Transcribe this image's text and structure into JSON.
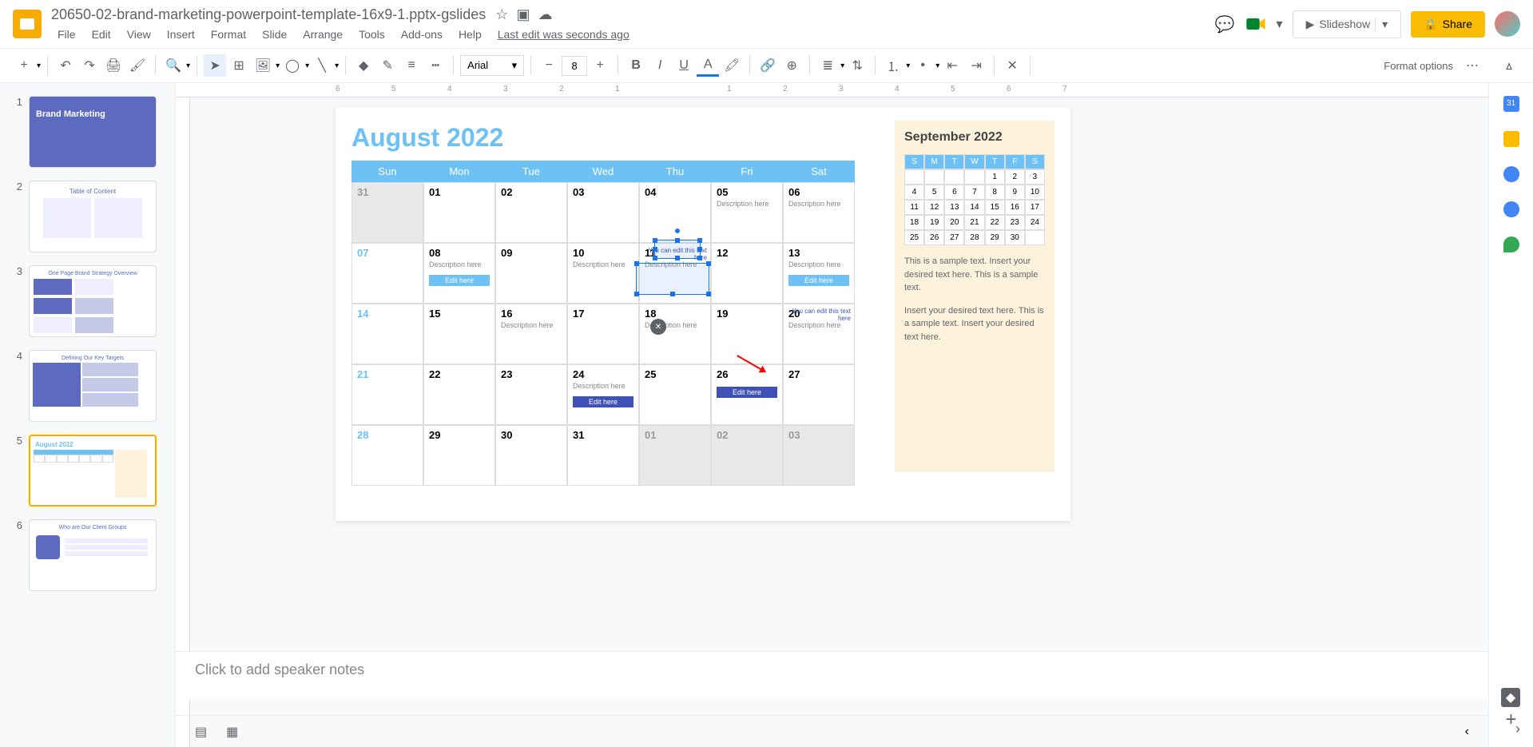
{
  "doc": {
    "title": "20650-02-brand-marketing-powerpoint-template-16x9-1.pptx-gslides"
  },
  "menu": {
    "file": "File",
    "edit": "Edit",
    "view": "View",
    "insert": "Insert",
    "format": "Format",
    "slide": "Slide",
    "arrange": "Arrange",
    "tools": "Tools",
    "addons": "Add-ons",
    "help": "Help",
    "last_edit": "Last edit was seconds ago"
  },
  "actions": {
    "slideshow": "Slideshow",
    "share": "Share"
  },
  "toolbar": {
    "font": "Arial",
    "size": "8",
    "format_options": "Format options"
  },
  "thumbs": [
    {
      "num": "1",
      "label": "Brand Marketing"
    },
    {
      "num": "2",
      "label": "Table of Content"
    },
    {
      "num": "3",
      "label": "One Page Brand Strategy Overview"
    },
    {
      "num": "4",
      "label": "Defining Our Key Targets"
    },
    {
      "num": "5",
      "label": "August 2022"
    },
    {
      "num": "6",
      "label": "Who are Our Client Groups"
    }
  ],
  "calendar": {
    "title": "August 2022",
    "days": [
      "Sun",
      "Mon",
      "Tue",
      "Wed",
      "Thu",
      "Fri",
      "Sat"
    ],
    "cells": [
      {
        "n": "31",
        "gray": true
      },
      {
        "n": "01"
      },
      {
        "n": "02"
      },
      {
        "n": "03"
      },
      {
        "n": "04"
      },
      {
        "n": "05",
        "desc": "Description here"
      },
      {
        "n": "06",
        "desc": "Description here"
      },
      {
        "n": "07",
        "sun": true
      },
      {
        "n": "08",
        "desc": "Description here",
        "btn": "Edit here",
        "light": true
      },
      {
        "n": "09"
      },
      {
        "n": "10",
        "desc": "Description here"
      },
      {
        "n": "11",
        "desc": "Description here",
        "edit": "You can edit this text here",
        "sel": true
      },
      {
        "n": "12"
      },
      {
        "n": "13",
        "desc": "Description here",
        "btn": "Edit here",
        "light": true
      },
      {
        "n": "14",
        "sun": true
      },
      {
        "n": "15"
      },
      {
        "n": "16",
        "desc": "Description here"
      },
      {
        "n": "17"
      },
      {
        "n": "18",
        "desc": "Description here"
      },
      {
        "n": "19"
      },
      {
        "n": "20",
        "desc": "Description here",
        "edit": "You can edit this text here"
      },
      {
        "n": "21",
        "sun": true
      },
      {
        "n": "22"
      },
      {
        "n": "23"
      },
      {
        "n": "24",
        "desc": "Description here",
        "btn": "Edit here"
      },
      {
        "n": "25"
      },
      {
        "n": "26",
        "btn": "Edit here"
      },
      {
        "n": "27"
      },
      {
        "n": "28",
        "sun": true
      },
      {
        "n": "29"
      },
      {
        "n": "30"
      },
      {
        "n": "31"
      },
      {
        "n": "01",
        "gray": true
      },
      {
        "n": "02",
        "gray": true
      },
      {
        "n": "03",
        "gray": true
      }
    ]
  },
  "sidebar": {
    "title": "September 2022",
    "days": [
      "S",
      "M",
      "T",
      "W",
      "T",
      "F",
      "S"
    ],
    "grid": [
      "",
      "",
      "",
      "",
      "1",
      "2",
      "3",
      "4",
      "5",
      "6",
      "7",
      "8",
      "9",
      "10",
      "11",
      "12",
      "13",
      "14",
      "15",
      "16",
      "17",
      "18",
      "19",
      "20",
      "21",
      "22",
      "23",
      "24",
      "25",
      "26",
      "27",
      "28",
      "29",
      "30",
      ""
    ],
    "text1": "This is a sample text. Insert your desired text here. This is a sample text.",
    "text2": "Insert your desired text here. This is a sample text. Insert your desired text here."
  },
  "notes": {
    "placeholder": "Click to add speaker notes"
  },
  "ruler": {
    "marks": [
      "6",
      "5",
      "4",
      "3",
      "2",
      "1",
      "",
      "1",
      "2",
      "3",
      "4",
      "5",
      "6",
      "7"
    ]
  }
}
